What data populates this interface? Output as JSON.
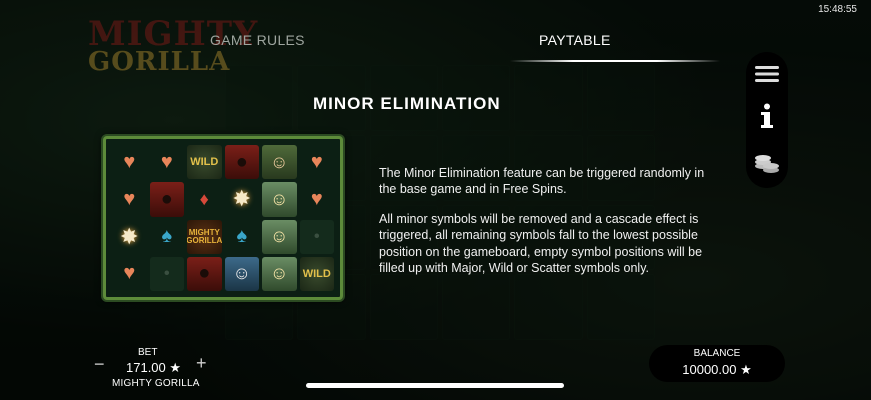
{
  "status": {
    "time": "15:48:55"
  },
  "logo": {
    "line1": "MIGHTY",
    "line2": "GORILLA"
  },
  "tabs": [
    {
      "label": "GAME RULES",
      "active": false
    },
    {
      "label": "PAYTABLE",
      "active": true
    }
  ],
  "side_menu": {
    "icons": [
      "menu-icon",
      "info-icon",
      "coins-icon"
    ]
  },
  "section": {
    "title": "MINOR ELIMINATION",
    "paragraphs": [
      "The Minor Elimination feature can be triggered randomly in the base game and in Free Spins.",
      "All minor symbols will be removed and a cascade effect is triggered, all remaining symbols fall to the lowest possible position on the gameboard, empty symbol positions will be filled up with Major, Wild or Scatter symbols only."
    ]
  },
  "board": {
    "wild_label": "WILD",
    "logo_label": "MIGHTY GORILLA"
  },
  "bet": {
    "label": "BET",
    "value": "171.00 ★",
    "game_name": "MIGHTY GORILLA"
  },
  "balance": {
    "label": "BALANCE",
    "value": "10000.00 ★"
  },
  "colors": {
    "accent": "#ffffff",
    "board_border": "#5d8b3a",
    "heart": "#e8855a",
    "spade": "#3aa6c9"
  }
}
